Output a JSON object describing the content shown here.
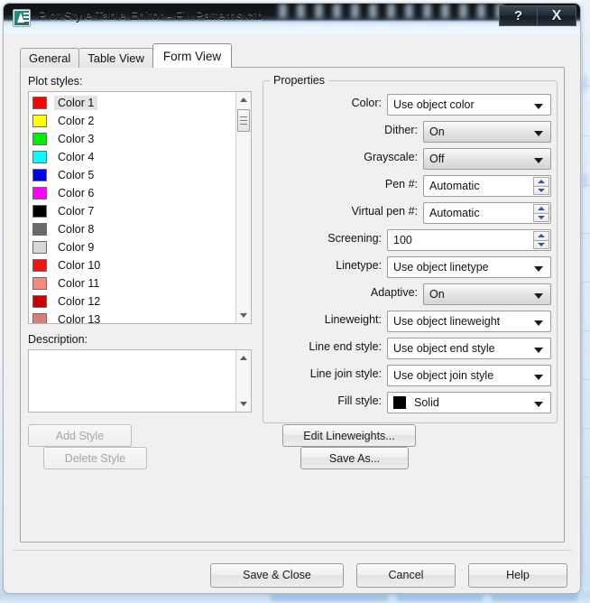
{
  "window": {
    "title": "Plot Style Table Editor - Fill Patterns.ctb",
    "icon": "autocad-icon",
    "help_button": "?",
    "close_button": "X"
  },
  "tabs": [
    {
      "label": "General",
      "active": false
    },
    {
      "label": "Table View",
      "active": false
    },
    {
      "label": "Form View",
      "active": true
    }
  ],
  "plot_styles": {
    "label": "Plot styles:",
    "items": [
      {
        "name": "Color 1",
        "color": "#ff0000",
        "selected": true
      },
      {
        "name": "Color 2",
        "color": "#ffff00",
        "selected": false
      },
      {
        "name": "Color 3",
        "color": "#00ee00",
        "selected": false
      },
      {
        "name": "Color 4",
        "color": "#00ffff",
        "selected": false
      },
      {
        "name": "Color 5",
        "color": "#0000f0",
        "selected": false
      },
      {
        "name": "Color 6",
        "color": "#ff00ff",
        "selected": false
      },
      {
        "name": "Color 7",
        "color": "#000000",
        "selected": false
      },
      {
        "name": "Color 8",
        "color": "#696969",
        "selected": false
      },
      {
        "name": "Color 9",
        "color": "#d8d8d8",
        "selected": false
      },
      {
        "name": "Color 10",
        "color": "#f21414",
        "selected": false
      },
      {
        "name": "Color 11",
        "color": "#f58a7e",
        "selected": false
      },
      {
        "name": "Color 12",
        "color": "#c80000",
        "selected": false
      },
      {
        "name": "Color 13",
        "color": "#d4807a",
        "selected": false
      }
    ]
  },
  "description": {
    "label": "Description:",
    "value": ""
  },
  "left_buttons": {
    "add_style": "Add Style",
    "delete_style": "Delete Style"
  },
  "properties": {
    "title": "Properties",
    "fields": [
      {
        "label": "Color:",
        "value": "Use object color",
        "control": "combo",
        "state": "enabled"
      },
      {
        "label": "Dither:",
        "value": "On",
        "control": "combo-gray",
        "state": "disabled"
      },
      {
        "label": "Grayscale:",
        "value": "Off",
        "control": "combo-gray",
        "state": "disabled"
      },
      {
        "label": "Pen #:",
        "value": "Automatic",
        "control": "spinner",
        "state": "enabled"
      },
      {
        "label": "Virtual pen #:",
        "value": "Automatic",
        "control": "spinner",
        "state": "enabled"
      },
      {
        "label": "Screening:",
        "value": "100",
        "control": "spinner",
        "state": "enabled"
      },
      {
        "label": "Linetype:",
        "value": "Use object linetype",
        "control": "combo",
        "state": "enabled"
      },
      {
        "label": "Adaptive:",
        "value": "On",
        "control": "combo-gray",
        "state": "disabled"
      },
      {
        "label": "Lineweight:",
        "value": "Use object lineweight",
        "control": "combo",
        "state": "enabled"
      },
      {
        "label": "Line end style:",
        "value": "Use object end style",
        "control": "combo",
        "state": "enabled"
      },
      {
        "label": "Line join style:",
        "value": "Use object join style",
        "control": "combo",
        "state": "enabled"
      },
      {
        "label": "Fill style:",
        "value": "Solid",
        "control": "combo-swatch",
        "swatch": "#000000",
        "state": "enabled"
      }
    ]
  },
  "right_buttons": {
    "edit_lineweights": "Edit Lineweights...",
    "save_as": "Save As..."
  },
  "footer_buttons": {
    "save_close": "Save & Close",
    "cancel": "Cancel",
    "help": "Help"
  },
  "colors": {
    "dialog_face": "#f0f0f0",
    "titlebar_dark": "#14181d",
    "titlebar_light": "#e9f3fb",
    "selection": "#e4e4e4",
    "spinner_arrow": "#35569c"
  }
}
